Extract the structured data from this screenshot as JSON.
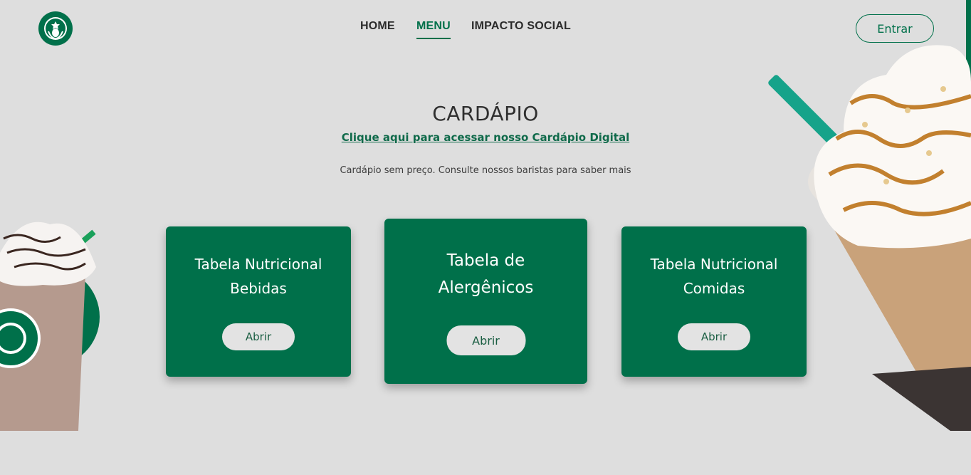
{
  "header": {
    "nav": [
      {
        "label": "HOME",
        "active": false
      },
      {
        "label": "MENU",
        "active": true
      },
      {
        "label": "IMPACTO SOCIAL",
        "active": false
      }
    ],
    "login_label": "Entrar"
  },
  "main": {
    "title": "CARDÁPIO",
    "digital_menu_link": "Clique aqui para acessar nosso Cardápio Digital",
    "subtitle": "Cardápio sem preço. Consulte nossos baristas para saber mais",
    "cards": [
      {
        "title_line1": "Tabela Nutricional",
        "title_line2": "Bebidas",
        "button_label": "Abrir"
      },
      {
        "title_line1": "Tabela de",
        "title_line2": "Alergênicos",
        "button_label": "Abrir"
      },
      {
        "title_line1": "Tabela Nutricional",
        "title_line2": "Comidas",
        "button_label": "Abrir"
      }
    ]
  },
  "colors": {
    "brand_green": "#00704a",
    "background": "#dedede",
    "button_bg": "#e3e3e3"
  },
  "icons": {
    "logo": "starbucks-siren-logo"
  }
}
